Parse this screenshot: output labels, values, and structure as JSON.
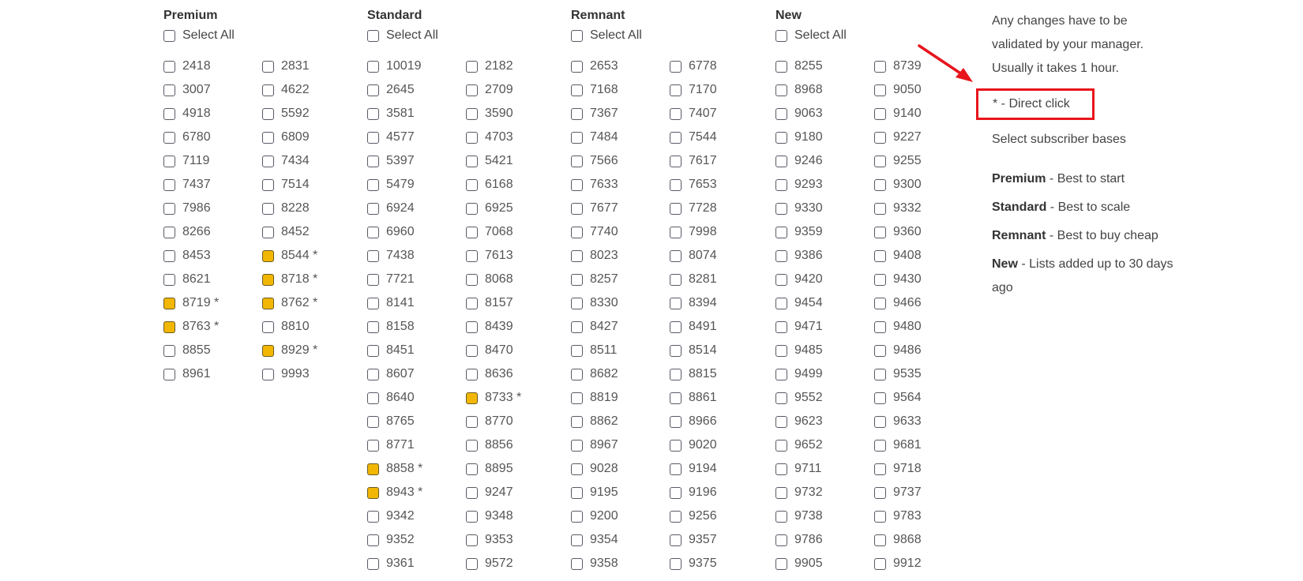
{
  "groups": [
    {
      "title": "Premium",
      "select_all": "Select All",
      "columns": [
        [
          {
            "label": "2418",
            "hl": false
          },
          {
            "label": "3007",
            "hl": false
          },
          {
            "label": "4918",
            "hl": false
          },
          {
            "label": "6780",
            "hl": false
          },
          {
            "label": "7119",
            "hl": false
          },
          {
            "label": "7437",
            "hl": false
          },
          {
            "label": "7986",
            "hl": false
          },
          {
            "label": "8266",
            "hl": false
          },
          {
            "label": "8453",
            "hl": false
          },
          {
            "label": "8621",
            "hl": false
          },
          {
            "label": "8719 *",
            "hl": true
          },
          {
            "label": "8763 *",
            "hl": true
          },
          {
            "label": "8855",
            "hl": false
          },
          {
            "label": "8961",
            "hl": false
          }
        ],
        [
          {
            "label": "2831",
            "hl": false
          },
          {
            "label": "4622",
            "hl": false
          },
          {
            "label": "5592",
            "hl": false
          },
          {
            "label": "6809",
            "hl": false
          },
          {
            "label": "7434",
            "hl": false
          },
          {
            "label": "7514",
            "hl": false
          },
          {
            "label": "8228",
            "hl": false
          },
          {
            "label": "8452",
            "hl": false
          },
          {
            "label": "8544 *",
            "hl": true
          },
          {
            "label": "8718 *",
            "hl": true
          },
          {
            "label": "8762 *",
            "hl": true
          },
          {
            "label": "8810",
            "hl": false
          },
          {
            "label": "8929 *",
            "hl": true
          },
          {
            "label": "9993",
            "hl": false
          }
        ]
      ]
    },
    {
      "title": "Standard",
      "select_all": "Select All",
      "columns": [
        [
          {
            "label": "10019",
            "hl": false
          },
          {
            "label": "2645",
            "hl": false
          },
          {
            "label": "3581",
            "hl": false
          },
          {
            "label": "4577",
            "hl": false
          },
          {
            "label": "5397",
            "hl": false
          },
          {
            "label": "5479",
            "hl": false
          },
          {
            "label": "6924",
            "hl": false
          },
          {
            "label": "6960",
            "hl": false
          },
          {
            "label": "7438",
            "hl": false
          },
          {
            "label": "7721",
            "hl": false
          },
          {
            "label": "8141",
            "hl": false
          },
          {
            "label": "8158",
            "hl": false
          },
          {
            "label": "8451",
            "hl": false
          },
          {
            "label": "8607",
            "hl": false
          },
          {
            "label": "8640",
            "hl": false
          },
          {
            "label": "8765",
            "hl": false
          },
          {
            "label": "8771",
            "hl": false
          },
          {
            "label": "8858 *",
            "hl": true
          },
          {
            "label": "8943 *",
            "hl": true
          },
          {
            "label": "9342",
            "hl": false
          },
          {
            "label": "9352",
            "hl": false
          },
          {
            "label": "9361",
            "hl": false
          }
        ],
        [
          {
            "label": "2182",
            "hl": false
          },
          {
            "label": "2709",
            "hl": false
          },
          {
            "label": "3590",
            "hl": false
          },
          {
            "label": "4703",
            "hl": false
          },
          {
            "label": "5421",
            "hl": false
          },
          {
            "label": "6168",
            "hl": false
          },
          {
            "label": "6925",
            "hl": false
          },
          {
            "label": "7068",
            "hl": false
          },
          {
            "label": "7613",
            "hl": false
          },
          {
            "label": "8068",
            "hl": false
          },
          {
            "label": "8157",
            "hl": false
          },
          {
            "label": "8439",
            "hl": false
          },
          {
            "label": "8470",
            "hl": false
          },
          {
            "label": "8636",
            "hl": false
          },
          {
            "label": "8733 *",
            "hl": true
          },
          {
            "label": "8770",
            "hl": false
          },
          {
            "label": "8856",
            "hl": false
          },
          {
            "label": "8895",
            "hl": false
          },
          {
            "label": "9247",
            "hl": false
          },
          {
            "label": "9348",
            "hl": false
          },
          {
            "label": "9353",
            "hl": false
          },
          {
            "label": "9572",
            "hl": false
          }
        ]
      ]
    },
    {
      "title": "Remnant",
      "select_all": "Select All",
      "columns": [
        [
          {
            "label": "2653",
            "hl": false
          },
          {
            "label": "7168",
            "hl": false
          },
          {
            "label": "7367",
            "hl": false
          },
          {
            "label": "7484",
            "hl": false
          },
          {
            "label": "7566",
            "hl": false
          },
          {
            "label": "7633",
            "hl": false
          },
          {
            "label": "7677",
            "hl": false
          },
          {
            "label": "7740",
            "hl": false
          },
          {
            "label": "8023",
            "hl": false
          },
          {
            "label": "8257",
            "hl": false
          },
          {
            "label": "8330",
            "hl": false
          },
          {
            "label": "8427",
            "hl": false
          },
          {
            "label": "8511",
            "hl": false
          },
          {
            "label": "8682",
            "hl": false
          },
          {
            "label": "8819",
            "hl": false
          },
          {
            "label": "8862",
            "hl": false
          },
          {
            "label": "8967",
            "hl": false
          },
          {
            "label": "9028",
            "hl": false
          },
          {
            "label": "9195",
            "hl": false
          },
          {
            "label": "9200",
            "hl": false
          },
          {
            "label": "9354",
            "hl": false
          },
          {
            "label": "9358",
            "hl": false
          }
        ],
        [
          {
            "label": "6778",
            "hl": false
          },
          {
            "label": "7170",
            "hl": false
          },
          {
            "label": "7407",
            "hl": false
          },
          {
            "label": "7544",
            "hl": false
          },
          {
            "label": "7617",
            "hl": false
          },
          {
            "label": "7653",
            "hl": false
          },
          {
            "label": "7728",
            "hl": false
          },
          {
            "label": "7998",
            "hl": false
          },
          {
            "label": "8074",
            "hl": false
          },
          {
            "label": "8281",
            "hl": false
          },
          {
            "label": "8394",
            "hl": false
          },
          {
            "label": "8491",
            "hl": false
          },
          {
            "label": "8514",
            "hl": false
          },
          {
            "label": "8815",
            "hl": false
          },
          {
            "label": "8861",
            "hl": false
          },
          {
            "label": "8966",
            "hl": false
          },
          {
            "label": "9020",
            "hl": false
          },
          {
            "label": "9194",
            "hl": false
          },
          {
            "label": "9196",
            "hl": false
          },
          {
            "label": "9256",
            "hl": false
          },
          {
            "label": "9357",
            "hl": false
          },
          {
            "label": "9375",
            "hl": false
          }
        ]
      ]
    },
    {
      "title": "New",
      "select_all": "Select All",
      "columns": [
        [
          {
            "label": "8255",
            "hl": false
          },
          {
            "label": "8968",
            "hl": false
          },
          {
            "label": "9063",
            "hl": false
          },
          {
            "label": "9180",
            "hl": false
          },
          {
            "label": "9246",
            "hl": false
          },
          {
            "label": "9293",
            "hl": false
          },
          {
            "label": "9330",
            "hl": false
          },
          {
            "label": "9359",
            "hl": false
          },
          {
            "label": "9386",
            "hl": false
          },
          {
            "label": "9420",
            "hl": false
          },
          {
            "label": "9454",
            "hl": false
          },
          {
            "label": "9471",
            "hl": false
          },
          {
            "label": "9485",
            "hl": false
          },
          {
            "label": "9499",
            "hl": false
          },
          {
            "label": "9552",
            "hl": false
          },
          {
            "label": "9623",
            "hl": false
          },
          {
            "label": "9652",
            "hl": false
          },
          {
            "label": "9711",
            "hl": false
          },
          {
            "label": "9732",
            "hl": false
          },
          {
            "label": "9738",
            "hl": false
          },
          {
            "label": "9786",
            "hl": false
          },
          {
            "label": "9905",
            "hl": false
          }
        ],
        [
          {
            "label": "8739",
            "hl": false
          },
          {
            "label": "9050",
            "hl": false
          },
          {
            "label": "9140",
            "hl": false
          },
          {
            "label": "9227",
            "hl": false
          },
          {
            "label": "9255",
            "hl": false
          },
          {
            "label": "9300",
            "hl": false
          },
          {
            "label": "9332",
            "hl": false
          },
          {
            "label": "9360",
            "hl": false
          },
          {
            "label": "9408",
            "hl": false
          },
          {
            "label": "9430",
            "hl": false
          },
          {
            "label": "9466",
            "hl": false
          },
          {
            "label": "9480",
            "hl": false
          },
          {
            "label": "9486",
            "hl": false
          },
          {
            "label": "9535",
            "hl": false
          },
          {
            "label": "9564",
            "hl": false
          },
          {
            "label": "9633",
            "hl": false
          },
          {
            "label": "9681",
            "hl": false
          },
          {
            "label": "9718",
            "hl": false
          },
          {
            "label": "9737",
            "hl": false
          },
          {
            "label": "9783",
            "hl": false
          },
          {
            "label": "9868",
            "hl": false
          },
          {
            "label": "9912",
            "hl": false
          }
        ]
      ]
    }
  ],
  "sidebar": {
    "note_lines": [
      "Any changes have to be",
      "validated by your manager.",
      "Usually it takes 1 hour."
    ],
    "direct_click": "* - Direct click",
    "select_bases": "Select subscriber bases",
    "legend": [
      {
        "name": "Premium",
        "desc": " - Best to start"
      },
      {
        "name": "Standard",
        "desc": " - Best to scale"
      },
      {
        "name": "Remnant",
        "desc": " - Best to buy cheap"
      },
      {
        "name": "New",
        "desc": " - Lists added up to 30 days ago"
      }
    ]
  },
  "colors": {
    "highlight": "#f2b705",
    "annotation_red": "#e8141c"
  },
  "icons": {
    "annotation": "red-arrow-icon"
  }
}
